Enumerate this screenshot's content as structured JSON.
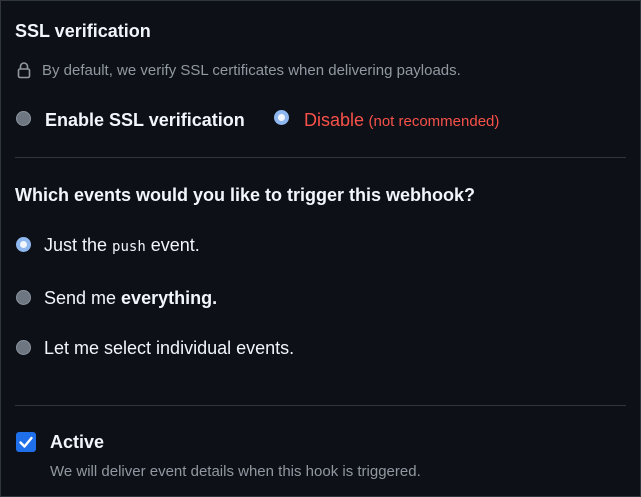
{
  "ssl": {
    "title": "SSL verification",
    "description": "By default, we verify SSL certificates when delivering payloads.",
    "enable_label": "Enable SSL verification",
    "disable_label": "Disable",
    "disable_note": "(not recommended)",
    "selected": "disable"
  },
  "events": {
    "title": "Which events would you like to trigger this webhook?",
    "options": [
      {
        "pre": "Just the ",
        "code": "push",
        "post": " event.",
        "selected": true
      },
      {
        "pre": "Send me ",
        "bold": "everything.",
        "selected": false
      },
      {
        "pre": "Let me select individual events.",
        "selected": false
      }
    ]
  },
  "active": {
    "label": "Active",
    "checked": true,
    "description": "We will deliver event details when this hook is triggered."
  },
  "icons": {
    "lock": "lock-icon",
    "check": "check-icon"
  },
  "colors": {
    "background": "#0d1117",
    "danger": "#f85149",
    "accent": "#1f6feb",
    "radio_selected_ring": "#8fb8f0"
  }
}
